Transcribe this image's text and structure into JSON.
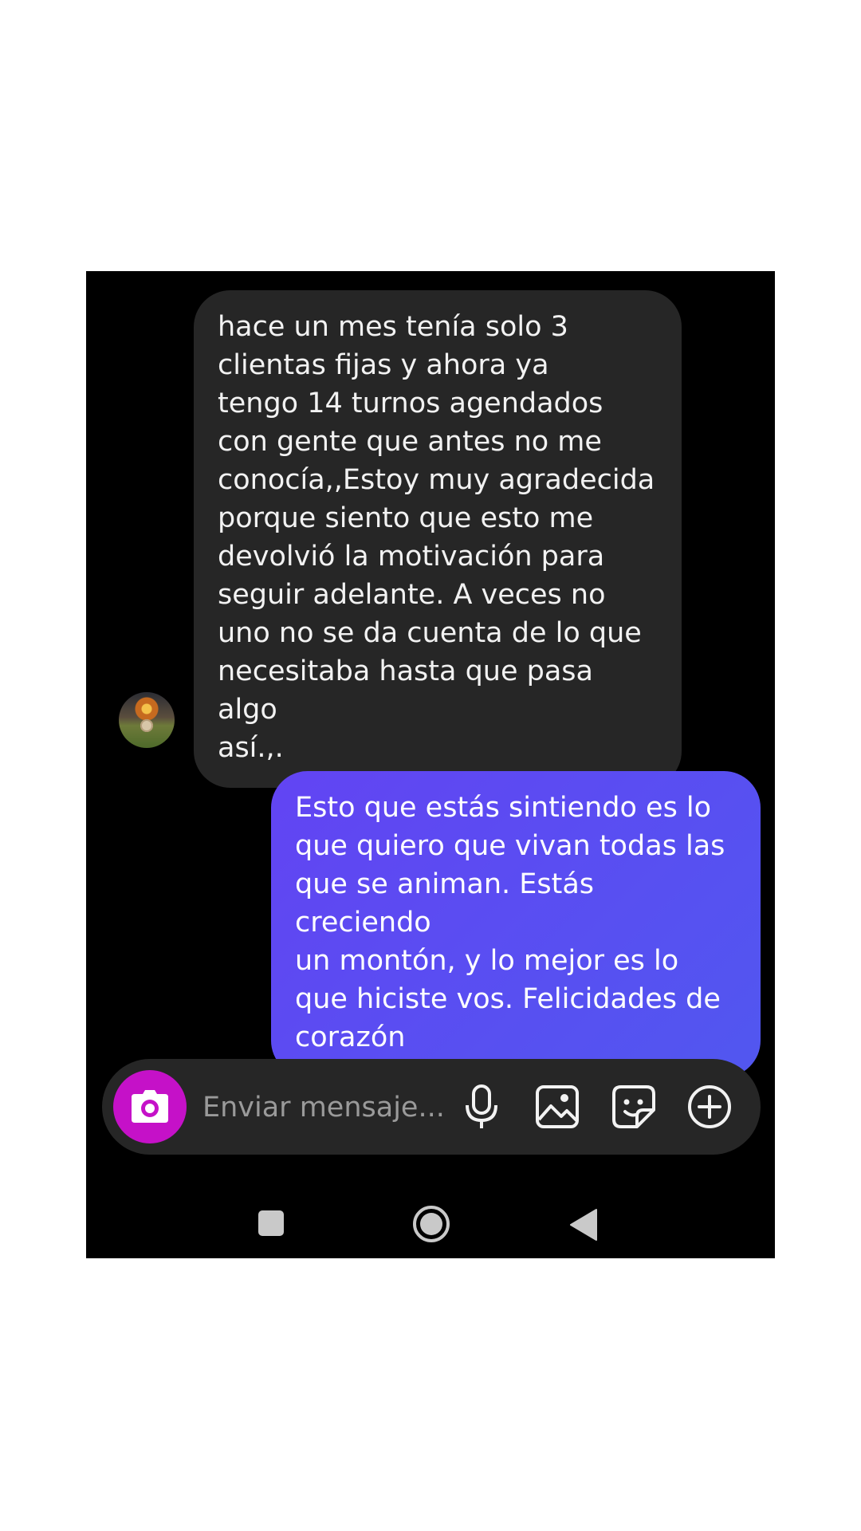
{
  "conversation": {
    "incoming": {
      "text": "hace un mes tenía solo 3\nclientas fijas y ahora ya\ntengo 14 turnos agendados\ncon gente que antes no me\nconocía,,Estoy muy agradecida\nporque siento que esto me\ndevolvió la motivación para\nseguir adelante. A veces no\nuno no se da cuenta de lo que\nnecesitaba hasta que pasa algo\nasí.,."
    },
    "outgoing": {
      "text": "Esto que estás sintiendo es lo\nque quiero que vivan todas las\nque se animan. Estás creciendo\nun montón, y lo mejor es lo\nque hiciste vos. Felicidades de\ncorazón"
    }
  },
  "composer": {
    "placeholder": "Enviar mensaje..."
  },
  "icons": [
    "camera-icon",
    "microphone-icon",
    "gallery-icon",
    "sticker-icon",
    "plus-icon"
  ],
  "navbar": [
    "recents-icon",
    "home-icon",
    "back-icon"
  ],
  "colors": {
    "background": "#000000",
    "incoming_bubble": "#262626",
    "outgoing_bubble": "#5a4ff2",
    "camera_button": "#c511c8"
  }
}
